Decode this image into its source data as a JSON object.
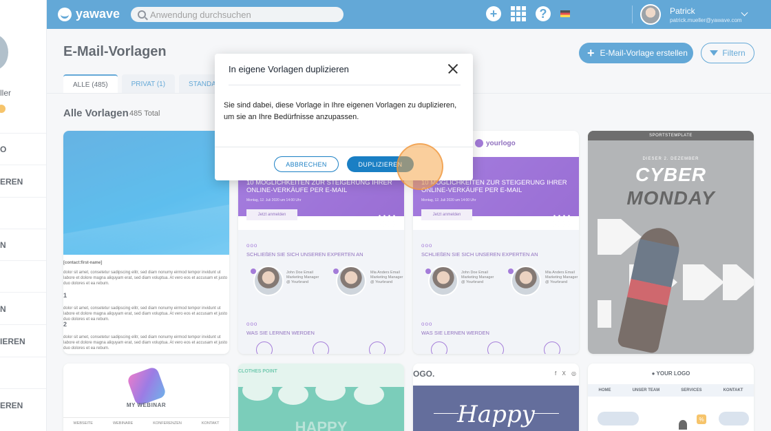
{
  "header": {
    "logo_text": "yawave",
    "search_placeholder": "Anwendung durchsuchen",
    "user_name": "Patrick",
    "user_email": "patrick.mueller@yawave.com"
  },
  "sidebar": {
    "name_fragment": "ller",
    "items": [
      "O",
      "EREN",
      "N",
      "N",
      "IEREN",
      "EREN"
    ]
  },
  "page": {
    "title": "E-Mail-Vorlagen",
    "create_button": "E-Mail-Vorlage erstellen",
    "filter_button": "Filtern",
    "tabs": [
      {
        "label": "ALLE (485)",
        "active": true
      },
      {
        "label": "PRIVAT (1)",
        "active": false
      },
      {
        "label": "STANDARD (4",
        "active": false
      }
    ],
    "section_title": "Alle Vorlagen",
    "section_count": "485 Total"
  },
  "cards": {
    "c1": {
      "placeholder": "[contact:first-name]",
      "para1": "dolor sit amet, consetetur sadipscing elitr, sed diam nonumy eirmod tempor invidunt ut labore et dolore magna aliquyam erat, sed diam voluptua. At vero eos et accusam et justo duo dolores et ea rebum.",
      "num1": "1",
      "para2": "dolor sit amet, consetetur sadipscing elitr, sed diam nonumy eirmod tempor invidunt ut labore et dolore magna aliquyam erat, sed diam voluptua. At vero eos et accusam et justo duo dolores et ea rebum.",
      "num2": "2",
      "para3": "dolor sit amet, consetetur sadipscing elitr, sed diam nonumy eirmod tempor invidunt ut labore et dolore magna aliquyam erat, sed diam voluptua. At vero eos et accusam et justo duo dolores et ea rebum."
    },
    "purple": {
      "logo": "yourlogo",
      "headline": "10 MÖGLICHKEITEN ZUR STEIGERUNG IHRER ONLINE-VERKÄUFE PER E-MAIL",
      "date": "Montag, 12. Juli 2020 um 14:00 Uhr",
      "button": "Jetzt anmelden",
      "ooo": "ooo",
      "sub1": "SCHLIEßEN SIE SICH UNSEREN EXPERTEN AN",
      "person1": "John Doe Email Marketing Manager @ Yourbrand",
      "person2": "Mia Anders Email Marketing Manager @ Yourbrand",
      "sub2": "WAS SIE LERNEN WERDEN"
    },
    "cyber": {
      "brand": "SPORTSTEMPLATE",
      "date": "DIESER 2. DEZEMBER",
      "title1": "CYBER",
      "title2": "MONDAY"
    },
    "webinar": {
      "title": "MY WEBINAR",
      "nav": [
        "WEBSEITE",
        "WEBINARE",
        "KONFERENZEN",
        "KONTAKT"
      ]
    },
    "clothes": {
      "logo": "CLOTHES POINT",
      "happy": "HAPPY"
    },
    "happy": {
      "logo": "OGO.",
      "social": "f X ◎",
      "script": "Happy"
    },
    "yourlogo": {
      "title": "● YOUR LOGO",
      "nav": [
        "HOME",
        "UNSER TEAM",
        "SERVICES",
        "KONTAKT"
      ],
      "badge": "%"
    }
  },
  "modal": {
    "title": "In eigene Vorlagen duplizieren",
    "body": "Sie sind dabei, diese Vorlage in Ihre eigenen Vorlagen zu duplizieren, um sie an Ihre Bedürfnisse anzupassen.",
    "cancel": "ABBRECHEN",
    "confirm": "DUPLIZIEREN"
  },
  "colors": {
    "primary": "#1a7fc4",
    "purple": "#6a2bc0",
    "accent": "#f6a84d"
  }
}
